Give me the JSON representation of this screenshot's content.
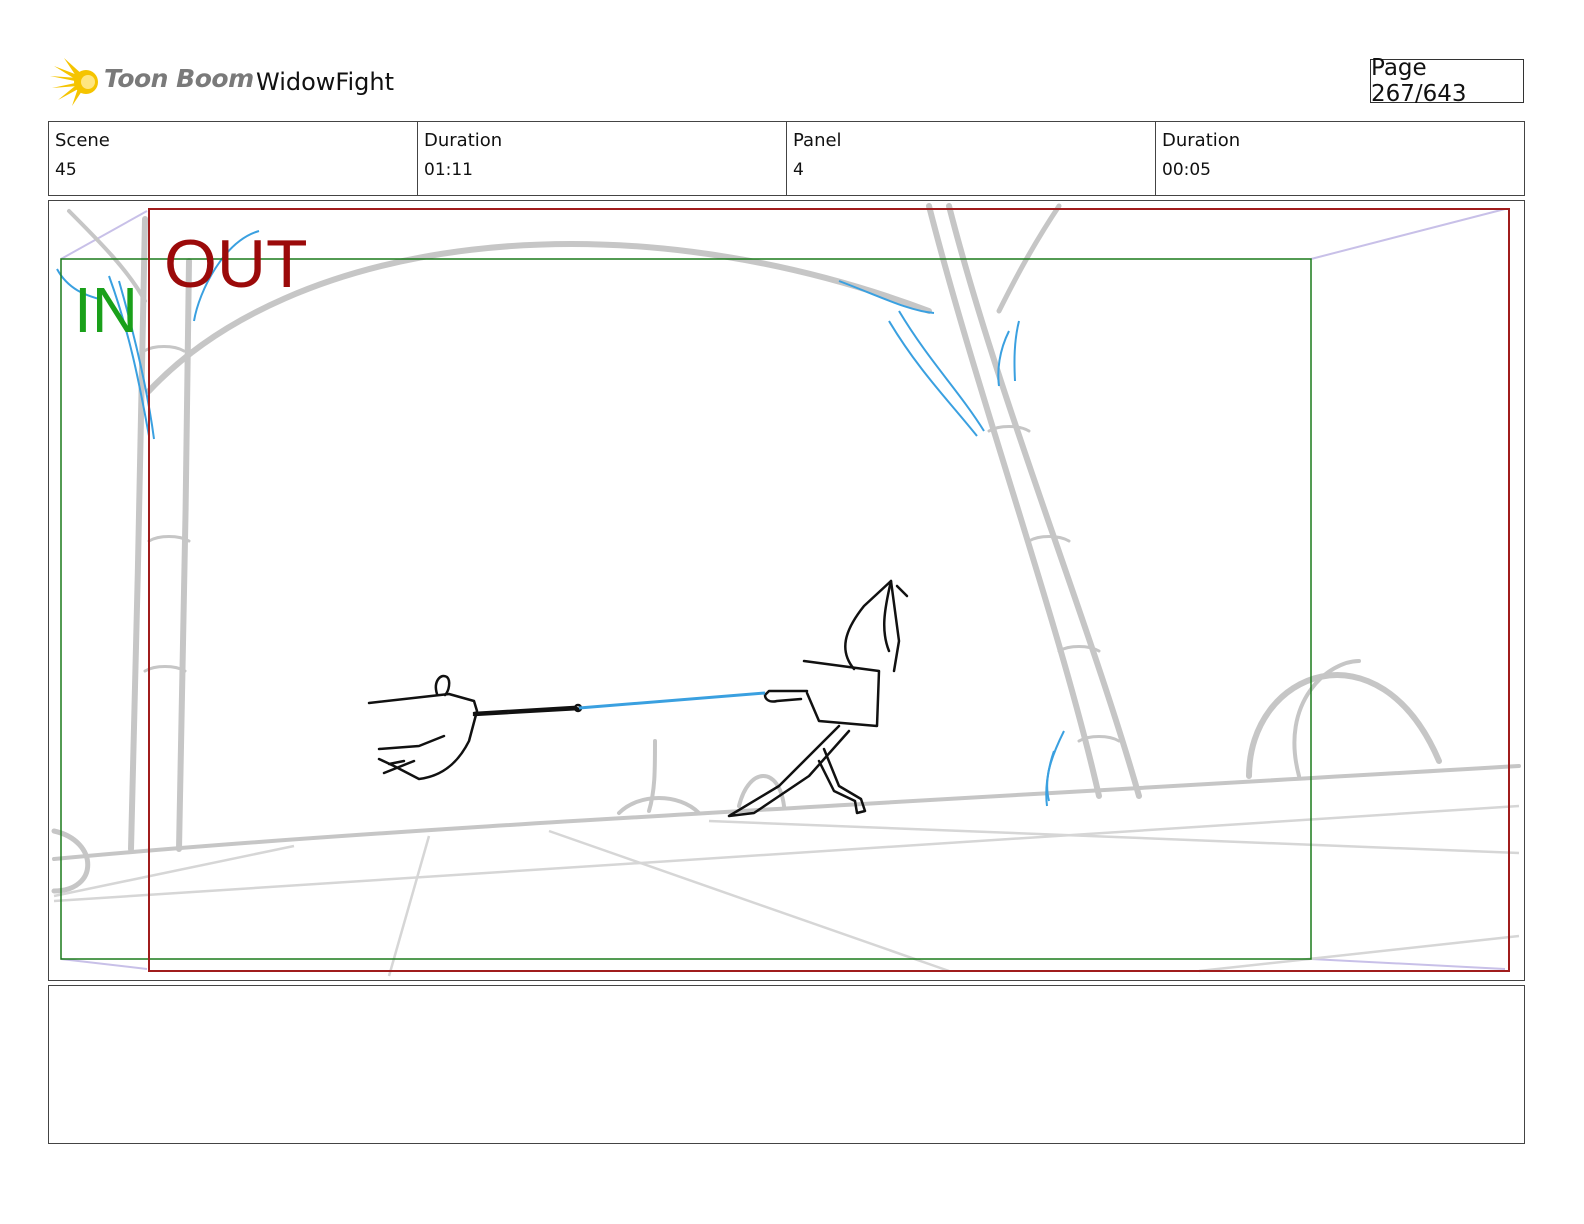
{
  "header": {
    "brand": "Toon Boom",
    "project_title": "WidowFight",
    "page_indicator": "Page 267/643"
  },
  "info": {
    "scene_label": "Scene",
    "scene_value": "45",
    "scene_duration_label": "Duration",
    "scene_duration_value": "01:11",
    "panel_label": "Panel",
    "panel_value": "4",
    "panel_duration_label": "Duration",
    "panel_duration_value": "00:05"
  },
  "panel": {
    "in_label": "IN",
    "out_label": "OUT"
  },
  "notes": {
    "text": ""
  },
  "colors": {
    "in_frame": "#1a7a1a",
    "out_frame": "#a01c1c",
    "sketch_gray": "#c4c4c4",
    "sketch_blue": "#3aa0e0",
    "logo_yellow": "#f5c400"
  }
}
